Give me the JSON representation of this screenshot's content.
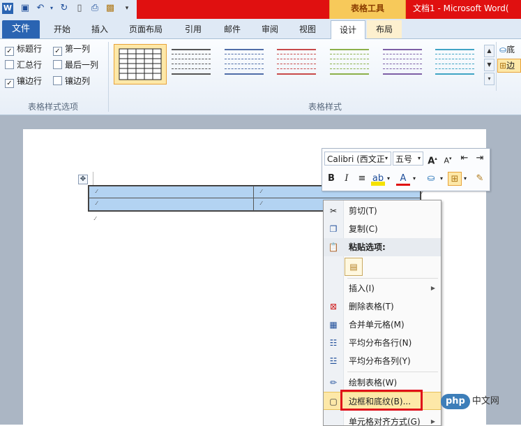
{
  "window": {
    "context_tab_group": "表格工具",
    "doc_title": "文档1 - Microsoft Word(",
    "qat_icons": [
      "word-logo-icon",
      "save-icon",
      "undo-icon",
      "undo-dropdown-icon",
      "redo-icon",
      "new-doc-icon",
      "print-preview-icon",
      "insert-picture-icon",
      "customize-qat-icon"
    ]
  },
  "ribbon": {
    "file_tab": "文件",
    "tabs": [
      "开始",
      "插入",
      "页面布局",
      "引用",
      "邮件",
      "审阅",
      "视图",
      "设计",
      "布局"
    ],
    "active_tab": "设计",
    "style_options": {
      "group_label": "表格样式选项",
      "items": [
        {
          "label": "标题行",
          "checked": true
        },
        {
          "label": "第一列",
          "checked": true
        },
        {
          "label": "汇总行",
          "checked": false
        },
        {
          "label": "最后一列",
          "checked": false
        },
        {
          "label": "镶边行",
          "checked": true
        },
        {
          "label": "镶边列",
          "checked": false
        }
      ]
    },
    "table_styles": {
      "group_label": "表格样式",
      "thumb_colors": [
        "#222222",
        "#555555",
        "#4f6da8",
        "#c84a4a",
        "#8cb04a",
        "#7d5fa6",
        "#3fa4c5"
      ]
    },
    "right_buttons": [
      "底",
      "边"
    ]
  },
  "mini_toolbar": {
    "font": "Calibri (西文正",
    "size": "五号"
  },
  "context_menu": {
    "items": [
      {
        "label": "剪切(T)",
        "icon": "scissors-icon"
      },
      {
        "label": "复制(C)",
        "icon": "copy-icon"
      },
      {
        "label": "粘贴选项:",
        "icon": "paste-icon"
      },
      {
        "label": "插入(I)",
        "icon": "",
        "submenu": true
      },
      {
        "label": "删除表格(T)",
        "icon": "delete-table-icon"
      },
      {
        "label": "合并单元格(M)",
        "icon": "merge-cells-icon"
      },
      {
        "label": "平均分布各行(N)",
        "icon": "distribute-rows-icon"
      },
      {
        "label": "平均分布各列(Y)",
        "icon": "distribute-columns-icon"
      },
      {
        "label": "绘制表格(W)",
        "icon": "draw-table-icon"
      },
      {
        "label": "边框和底纹(B)...",
        "icon": "borders-icon"
      },
      {
        "label": "单元格对齐方式(G)",
        "icon": "",
        "submenu": true
      }
    ]
  },
  "watermark": {
    "brand": "php",
    "text": "中文网"
  }
}
